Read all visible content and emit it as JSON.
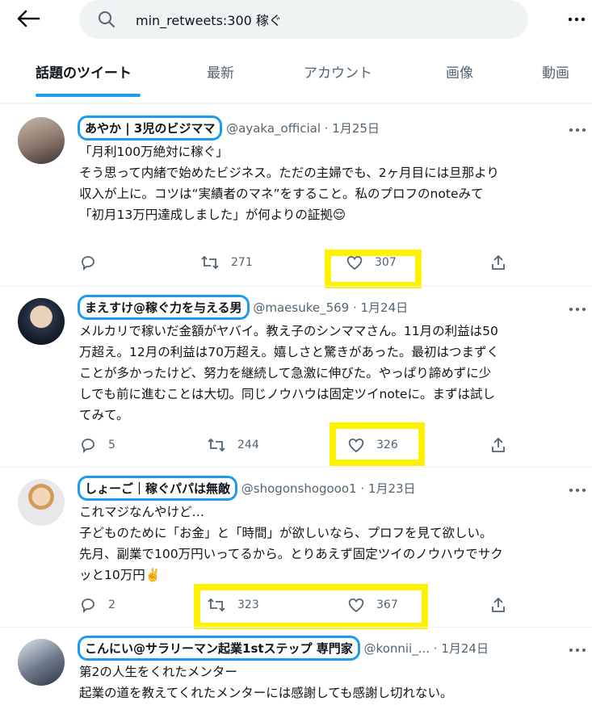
{
  "search": {
    "query": "min_retweets:300 稼ぐ"
  },
  "tabs": [
    "話題のツイート",
    "最新",
    "アカウント",
    "画像",
    "動画"
  ],
  "tweets": [
    {
      "name": "あやか | 3児のビジママ",
      "meta": "@ayaka_official · 1月25日",
      "lines": [
        "「月利100万絶対に稼ぐ」",
        "",
        "そう思って内緒で始めたビジネス。ただの主婦でも、2ヶ月目には旦那より",
        "収入が上に。コツは“実績者のマネ”をすること。私のプロフのnoteみて",
        "「初月13万円達成しました」が何よりの証拠😌"
      ],
      "replies": "",
      "retweets": "271",
      "likes": "307"
    },
    {
      "name": "まえすけ@稼ぐ力を与える男",
      "meta": "@maesuke_569 · 1月24日",
      "lines": [
        "メルカリで稼いだ金額がヤバイ。教え子のシンママさん。11月の利益は50",
        "万超え。12月の利益は70万超え。嬉しさと驚きがあった。最初はつまずく",
        "ことが多かったけど、努力を継続して急激に伸びた。やっぱり諦めずに少",
        "しでも前に進むことは大切。同じノウハウは固定ツイnoteに。まずは試し",
        "てみて。"
      ],
      "replies": "5",
      "retweets": "244",
      "likes": "326"
    },
    {
      "name": "しょーご｜稼ぐパパは無敵",
      "meta": "@shogonshogooo1 · 1月23日",
      "lines": [
        "これマジなんやけど…",
        "子どものために「お金」と「時間」が欲しいなら、プロフを見て欲しい。",
        "先月、副業で100万円いってるから。とりあえず固定ツイのノウハウでサク",
        "ッと10万円✌️"
      ],
      "replies": "2",
      "retweets": "323",
      "likes": "367"
    },
    {
      "name": "こんにい@サラリーマン起業1stステップ 専門家",
      "meta": "@konnii_... · 1月24日",
      "lines": [
        "第2の人生をくれたメンター",
        "",
        "起業の道を教えてくれたメンターには感謝しても感謝し切れない。"
      ],
      "replies": "",
      "retweets": "",
      "likes": ""
    }
  ],
  "colors": {
    "accent": "#1d9bf0",
    "highlight": "#fff200",
    "muted": "#536471"
  },
  "icons": [
    "back-arrow-icon",
    "search-icon",
    "more-icon",
    "reply-icon",
    "retweet-icon",
    "like-icon",
    "share-icon"
  ]
}
